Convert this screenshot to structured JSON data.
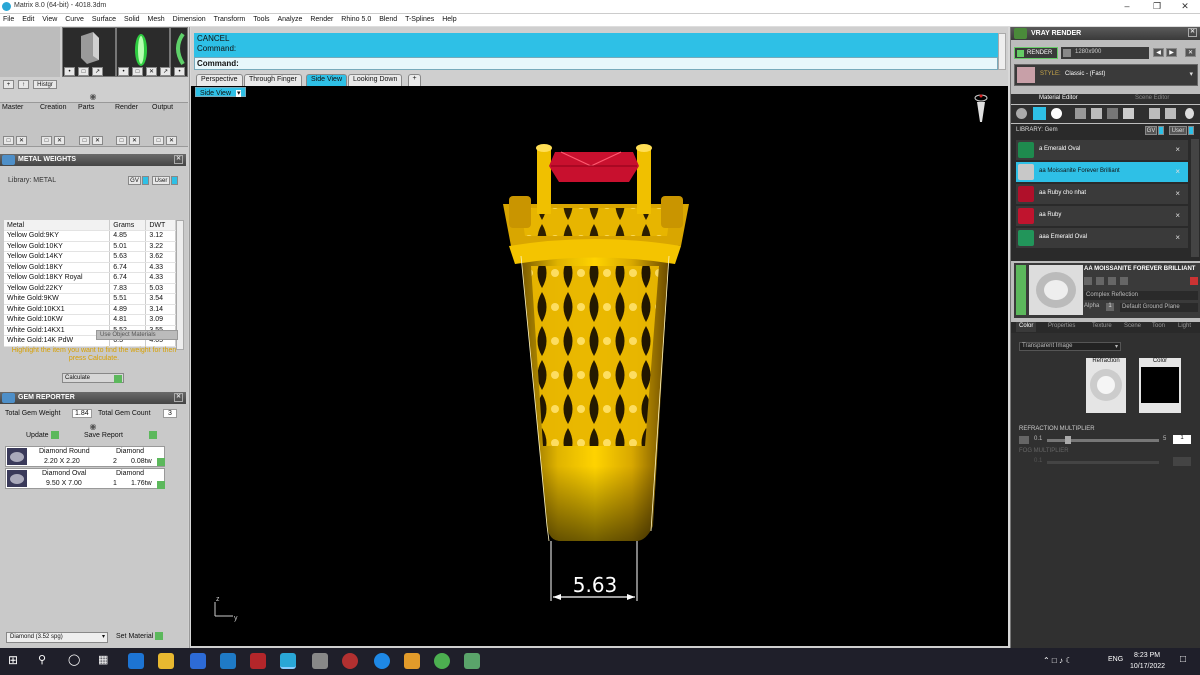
{
  "window": {
    "title": "Matrix 8.0 (64-bit) - 4018.3dm"
  },
  "menu": [
    "File",
    "Edit",
    "View",
    "Curve",
    "Surface",
    "Solid",
    "Mesh",
    "Dimension",
    "Transform",
    "Tools",
    "Analyze",
    "Render",
    "Rhino 5.0",
    "Blend",
    "T-Splines",
    "Help"
  ],
  "left_toolbar": {
    "histgr_label": "Histgr",
    "tabs": [
      "Master",
      "Creation",
      "Parts",
      "Render",
      "Output"
    ]
  },
  "metal_weights": {
    "title": "METAL WEIGHTS",
    "library_label": "Library: METAL",
    "library_btns": [
      "GV",
      "User"
    ],
    "columns": [
      "Metal",
      "Grams",
      "DWT"
    ],
    "rows": [
      [
        "Yellow Gold:9KY",
        "4.85",
        "3.12"
      ],
      [
        "Yellow Gold:10KY",
        "5.01",
        "3.22"
      ],
      [
        "Yellow Gold:14KY",
        "5.63",
        "3.62"
      ],
      [
        "Yellow Gold:18KY",
        "6.74",
        "4.33"
      ],
      [
        "Yellow Gold:18KY Royal",
        "6.74",
        "4.33"
      ],
      [
        "Yellow Gold:22KY",
        "7.83",
        "5.03"
      ],
      [
        "White Gold:9KW",
        "5.51",
        "3.54"
      ],
      [
        "White Gold:10KX1",
        "4.89",
        "3.14"
      ],
      [
        "White Gold:10KW",
        "4.81",
        "3.09"
      ],
      [
        "White Gold:14KX1",
        "5.52",
        "3.55"
      ],
      [
        "White Gold:14K PdW",
        "6.3",
        "4.05"
      ]
    ],
    "use_object_materials": "Use Object Materials",
    "hint": "Highlight the item you want to find the weight for then press Calculate.",
    "calculate": "Calculate"
  },
  "gem_reporter": {
    "title": "GEM REPORTER",
    "total_weight_label": "Total Gem Weight",
    "total_weight": "1.84",
    "total_count_label": "Total Gem Count",
    "total_count": "3",
    "update": "Update",
    "save_report": "Save Report",
    "gems": [
      {
        "shape": "Diamond Round",
        "size": "2.20 X 2.20",
        "material": "Diamond",
        "count": "2",
        "weight": "0.08tw"
      },
      {
        "shape": "Diamond Oval",
        "size": "9.50 X 7.00",
        "material": "Diamond",
        "count": "1",
        "weight": "1.76tw"
      }
    ],
    "material_select": "Diamond  (3.52 spg)",
    "set_material": "Set Material"
  },
  "command": {
    "line1": "CANCEL",
    "line2": "Command:",
    "prompt": "Command:"
  },
  "view_tabs": [
    "Perspective",
    "Through Finger",
    "Side View",
    "Looking Down"
  ],
  "active_view": "Side View",
  "viewport": {
    "label": "Side View",
    "dimension": "5.63",
    "axis_z": "z",
    "axis_y": "y"
  },
  "vray": {
    "title": "VRAY RENDER",
    "render": "RENDER",
    "resolution": "1280x900",
    "style_label": "STYLE:",
    "style": "Classic - (Fast)",
    "tabs": [
      "Material Editor",
      "Scene Editor"
    ],
    "library_label": "LIBRARY: Gem",
    "library_btns": [
      "GV",
      "User"
    ],
    "materials": [
      {
        "name": "a Emerald Oval",
        "color": "#1e8a4e"
      },
      {
        "name": "aa Moissanite Forever Brilliant",
        "color": "#c8c8c8"
      },
      {
        "name": "aa Ruby cho nhat",
        "color": "#b0102a"
      },
      {
        "name": "aa Ruby",
        "color": "#c0142e"
      },
      {
        "name": "aaa Emerald Oval",
        "color": "#22955a"
      }
    ],
    "selected_title": "AA MOISSANITE FOREVER BRILLIANT",
    "reflection": "Complex Reflection",
    "alpha": "Alpha",
    "alpha_value": "1",
    "ground": "Default Ground Plane",
    "subtabs": [
      "Color",
      "Properties",
      "Texture",
      "Scene",
      "Toon",
      "Light"
    ],
    "layer_select": "Transparent Image",
    "refraction_label": "Refraction",
    "color_label": "Color",
    "refraction_multiplier": "REFRACTION MULTIPLIER",
    "rm_min": "0.1",
    "rm_max": "5",
    "rm_value": "1",
    "fog_label": "FOG MULTIPLIER",
    "fog_min": "0.1"
  },
  "taskbar": {
    "lang": "ENG",
    "time": "8:23 PM",
    "date": "10/17/2022"
  }
}
